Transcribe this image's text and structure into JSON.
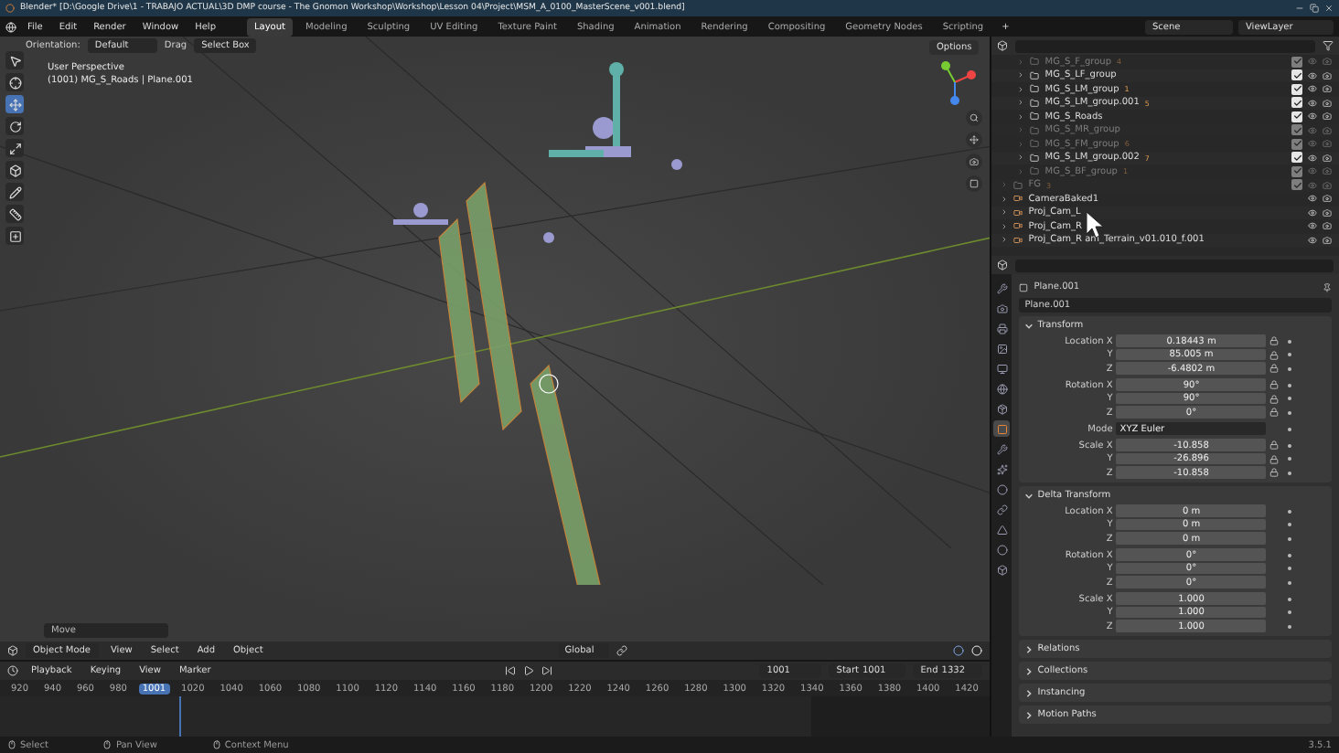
{
  "window": {
    "title": "Blender* [D:\\Google Drive\\1 - TRABAJO ACTUAL\\3D DMP course - The Gnomon Workshop\\Workshop\\Lesson 04\\Project\\MSM_A_0100_MasterScene_v001.blend]"
  },
  "menu": [
    "File",
    "Edit",
    "Render",
    "Window",
    "Help"
  ],
  "workspaces": [
    {
      "label": "Layout",
      "selected": true
    },
    {
      "label": "Modeling",
      "selected": false
    },
    {
      "label": "Sculpting",
      "selected": false
    },
    {
      "label": "UV Editing",
      "selected": false
    },
    {
      "label": "Texture Paint",
      "selected": false
    },
    {
      "label": "Shading",
      "selected": false
    },
    {
      "label": "Animation",
      "selected": false
    },
    {
      "label": "Rendering",
      "selected": false
    },
    {
      "label": "Compositing",
      "selected": false
    },
    {
      "label": "Geometry Nodes",
      "selected": false
    },
    {
      "label": "Scripting",
      "selected": false
    }
  ],
  "add_workspace": "+",
  "scene": "Scene",
  "view_layer": "ViewLayer",
  "viewport": {
    "orientation_label": "Orientation:",
    "orientation": "Default",
    "drag_label": "Drag",
    "drag": "Select Box",
    "options": "Options",
    "view_name": "User Perspective",
    "object_info": "(1001) MG_S_Roads | Plane.001",
    "last_operator": "Move",
    "tools": [
      {
        "kind": "select",
        "selected": false
      },
      {
        "kind": "cursor",
        "selected": false
      },
      {
        "kind": "move",
        "selected": true
      },
      {
        "kind": "rotate",
        "selected": false
      },
      {
        "kind": "scale",
        "selected": false
      },
      {
        "kind": "transform",
        "selected": false
      },
      {
        "kind": "annotate",
        "selected": false
      },
      {
        "kind": "measure",
        "selected": false
      },
      {
        "kind": "add",
        "selected": false
      }
    ],
    "mode": "Object Mode",
    "header_menu": [
      "View",
      "Select",
      "Add",
      "Object"
    ],
    "pivot": "Global"
  },
  "timeline": {
    "menu": [
      "Playback",
      "Keying",
      "View",
      "Marker"
    ],
    "frame": "1001",
    "start_label": "Start",
    "start": "1001",
    "end_label": "End",
    "end": "1332",
    "ruler": [
      {
        "label": "920",
        "current": false
      },
      {
        "label": "940",
        "current": false
      },
      {
        "label": "960",
        "current": false
      },
      {
        "label": "980",
        "current": false
      },
      {
        "label": "1001",
        "current": true
      },
      {
        "label": "1020",
        "current": false
      },
      {
        "label": "1040",
        "current": false
      },
      {
        "label": "1060",
        "current": false
      },
      {
        "label": "1080",
        "current": false
      },
      {
        "label": "1100",
        "current": false
      },
      {
        "label": "1120",
        "current": false
      },
      {
        "label": "1140",
        "current": false
      },
      {
        "label": "1160",
        "current": false
      },
      {
        "label": "1180",
        "current": false
      },
      {
        "label": "1200",
        "current": false
      },
      {
        "label": "1220",
        "current": false
      },
      {
        "label": "1240",
        "current": false
      },
      {
        "label": "1260",
        "current": false
      },
      {
        "label": "1280",
        "current": false
      },
      {
        "label": "1300",
        "current": false
      },
      {
        "label": "1320",
        "current": false
      },
      {
        "label": "1340",
        "current": false
      },
      {
        "label": "1360",
        "current": false
      },
      {
        "label": "1380",
        "current": false
      },
      {
        "label": "1400",
        "current": false
      },
      {
        "label": "1420",
        "current": false
      }
    ]
  },
  "outliner": {
    "rows": [
      {
        "kind": "collection",
        "name": "MG_S_F_group",
        "count": "4",
        "enabled": false,
        "checked": true
      },
      {
        "kind": "collection",
        "name": "MG_S_LF_group",
        "enabled": true,
        "checked": true
      },
      {
        "kind": "collection",
        "name": "MG_S_LM_group",
        "count": "1",
        "enabled": true,
        "checked": true
      },
      {
        "kind": "collection",
        "name": "MG_S_LM_group.001",
        "count": "5",
        "enabled": true,
        "checked": true
      },
      {
        "kind": "collection",
        "name": "MG_S_Roads",
        "enabled": true,
        "checked": true
      },
      {
        "kind": "collection",
        "name": "MG_S_MR_group",
        "enabled": false,
        "checked": true
      },
      {
        "kind": "collection",
        "name": "MG_S_FM_group",
        "count": "6",
        "enabled": false,
        "checked": true
      },
      {
        "kind": "collection",
        "name": "MG_S_LM_group.002",
        "count": "7",
        "enabled": true,
        "checked": true
      },
      {
        "kind": "collection",
        "name": "MG_S_BF_group",
        "count": "1",
        "enabled": false,
        "checked": true
      },
      {
        "kind": "group",
        "name": "FG",
        "count": "3",
        "enabled": false,
        "checked": true
      },
      {
        "kind": "object",
        "name": "CameraBaked1",
        "enabled": true
      },
      {
        "kind": "object",
        "name": "Proj_Cam_L",
        "enabled": true
      },
      {
        "kind": "object",
        "name": "Proj_Cam_R",
        "enabled": true
      },
      {
        "kind": "object",
        "name": "Proj_Cam_R am_Terrain_v01.010_f.001",
        "enabled": true
      }
    ]
  },
  "properties": {
    "object": "Plane.001",
    "datablock": "Plane.001",
    "tabs": [
      {
        "kind": "tool",
        "selected": false
      },
      {
        "kind": "render",
        "selected": false
      },
      {
        "kind": "output",
        "selected": false
      },
      {
        "kind": "view",
        "selected": false
      },
      {
        "kind": "scene",
        "selected": false
      },
      {
        "kind": "world",
        "selected": false
      },
      {
        "kind": "collection",
        "selected": false
      },
      {
        "kind": "object",
        "selected": true
      },
      {
        "kind": "modifier",
        "selected": false
      },
      {
        "kind": "particles",
        "selected": false
      },
      {
        "kind": "physics",
        "selected": false
      },
      {
        "kind": "constraint",
        "selected": false
      },
      {
        "kind": "data",
        "selected": false
      },
      {
        "kind": "material",
        "selected": false
      },
      {
        "kind": "texture",
        "selected": false
      }
    ],
    "panels": [
      {
        "title": "Transform",
        "expanded": true,
        "lockable": true,
        "groups": [
          [
            {
              "kind": "field",
              "label": "Location X",
              "value": "0.18443 m"
            },
            {
              "kind": "field",
              "label": "Y",
              "value": "85.005 m"
            },
            {
              "kind": "field",
              "label": "Z",
              "value": "-6.4802 m"
            }
          ],
          [
            {
              "kind": "field",
              "label": "Rotation X",
              "value": "90°"
            },
            {
              "kind": "field",
              "label": "Y",
              "value": "90°"
            },
            {
              "kind": "field",
              "label": "Z",
              "value": "0°"
            }
          ],
          [
            {
              "kind": "dropdown",
              "label": "Mode",
              "value": "XYZ Euler"
            }
          ],
          [
            {
              "kind": "field",
              "label": "Scale X",
              "value": "-10.858"
            },
            {
              "kind": "field",
              "label": "Y",
              "value": "-26.896"
            },
            {
              "kind": "field",
              "label": "Z",
              "value": "-10.858"
            }
          ]
        ]
      },
      {
        "title": "Delta Transform",
        "expanded": true,
        "lockable": false,
        "groups": [
          [
            {
              "kind": "field",
              "label": "Location X",
              "value": "0 m"
            },
            {
              "kind": "field",
              "label": "Y",
              "value": "0 m"
            },
            {
              "kind": "field",
              "label": "Z",
              "value": "0 m"
            }
          ],
          [
            {
              "kind": "field",
              "label": "Rotation X",
              "value": "0°"
            },
            {
              "kind": "field",
              "label": "Y",
              "value": "0°"
            },
            {
              "kind": "field",
              "label": "Z",
              "value": "0°"
            }
          ],
          [
            {
              "kind": "field",
              "label": "Scale X",
              "value": "1.000"
            },
            {
              "kind": "field",
              "label": "Y",
              "value": "1.000"
            },
            {
              "kind": "field",
              "label": "Z",
              "value": "1.000"
            }
          ]
        ]
      },
      {
        "title": "Relations",
        "expanded": false
      },
      {
        "title": "Collections",
        "expanded": false
      },
      {
        "title": "Instancing",
        "expanded": false
      },
      {
        "title": "Motion Paths",
        "expanded": false
      }
    ]
  },
  "status_bar": {
    "hints": [
      "Select",
      "Pan View",
      "Context Menu"
    ],
    "version": "3.5.1"
  }
}
